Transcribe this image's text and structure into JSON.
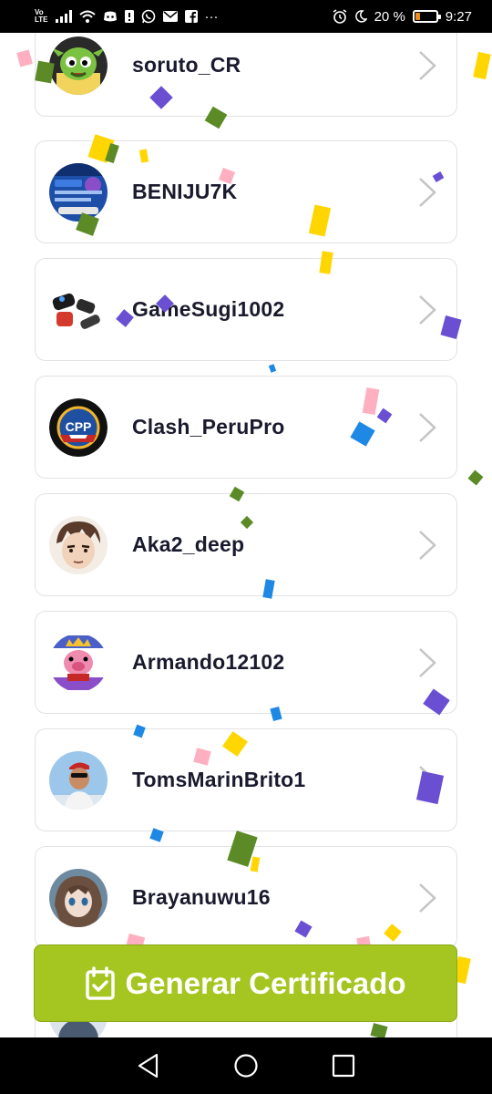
{
  "status_bar": {
    "volte_top": "Vo",
    "volte_bottom": "LTE",
    "more": "···",
    "battery_text": "20 %",
    "battery_level": 0.2,
    "time": "9:27",
    "icons": [
      "signal-icon",
      "wifi-icon",
      "discord-icon",
      "sim-alert-icon",
      "whatsapp-icon",
      "mail-icon",
      "facebook-icon",
      "alarm-icon",
      "moon-icon",
      "battery-icon"
    ]
  },
  "players": [
    {
      "name": "soruto_CR",
      "avatar": "green-goblin-avatar"
    },
    {
      "name": "BENIJU7K",
      "avatar": "game-screenshot-avatar"
    },
    {
      "name": "GameSugi1002",
      "avatar": "controllers-avatar"
    },
    {
      "name": "Clash_PeruPro",
      "avatar": "cpp-logo-avatar"
    },
    {
      "name": "Aka2_deep",
      "avatar": "anime-face-avatar"
    },
    {
      "name": "Armando12102",
      "avatar": "pig-king-avatar"
    },
    {
      "name": "TomsMarinBrito1",
      "avatar": "photo-person-avatar"
    },
    {
      "name": "Brayanuwu16",
      "avatar": "anime-girl-avatar"
    }
  ],
  "generate_button": {
    "label": "Generar Certificado",
    "color": "#a5c520"
  },
  "nav": {
    "back": "back-icon",
    "home": "home-icon",
    "recents": "recents-icon"
  },
  "confetti_colors": [
    "#ffd600",
    "#6a4fd3",
    "#5b8a26",
    "#ffb0c0",
    "#1e88e5"
  ]
}
